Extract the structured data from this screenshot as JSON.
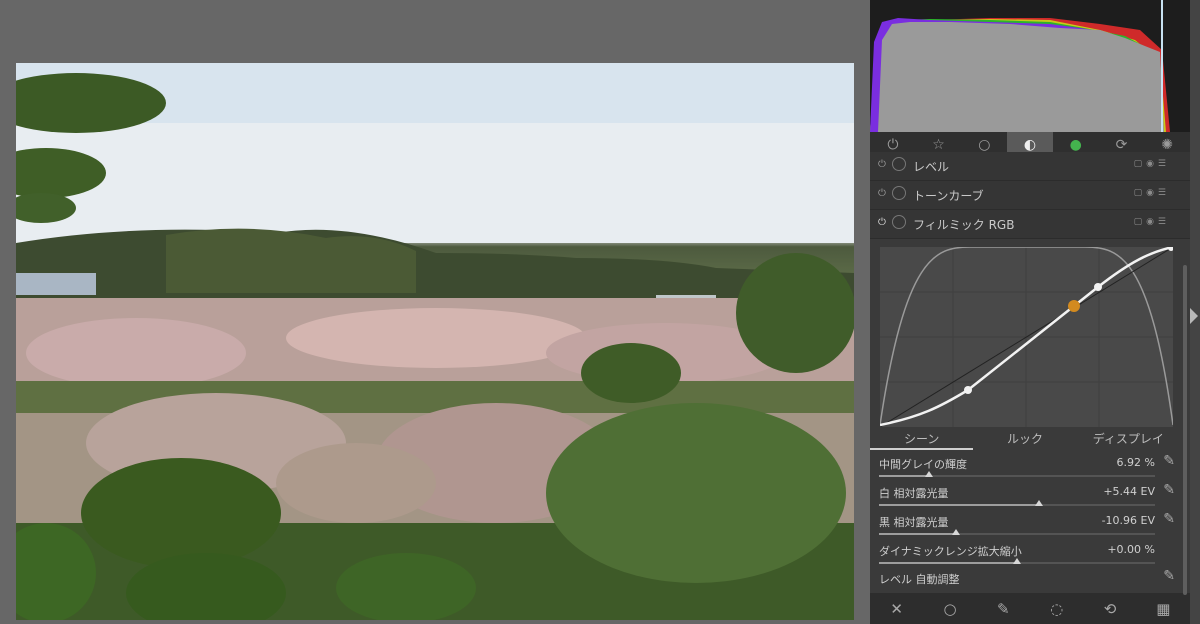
{
  "modules": [
    {
      "name": "レベル"
    },
    {
      "name": "トーンカーブ"
    },
    {
      "name": "フィルミック RGB"
    }
  ],
  "tabs_icons": [
    "power-icon",
    "star-icon",
    "circle-icon",
    "tone-icon",
    "color-icon",
    "correct-icon",
    "effect-icon"
  ],
  "sub_tabs": [
    "シーン",
    "ルック",
    "ディスプレイ"
  ],
  "params": [
    {
      "label": "中間グレイの輝度",
      "value": "6.92 %",
      "level": 0.18
    },
    {
      "label": "白 相対露光量",
      "value": "+5.44 EV",
      "level": 0.58
    },
    {
      "label": "黒 相対露光量",
      "value": "-10.96 EV",
      "level": 0.28
    },
    {
      "label": "ダイナミックレンジ拡大縮小",
      "value": "+0.00 %",
      "level": 0.5
    }
  ],
  "auto_level_label": "レベル 自動調整",
  "bottom_icons": [
    "reset-icon",
    "mask-off-icon",
    "drawn-mask-icon",
    "parametric-mask-icon",
    "combined-mask-icon",
    "raster-mask-icon"
  ],
  "colors": {
    "accent": "#d28a1f",
    "panel": "#3a3a3a",
    "background": "#676767"
  }
}
